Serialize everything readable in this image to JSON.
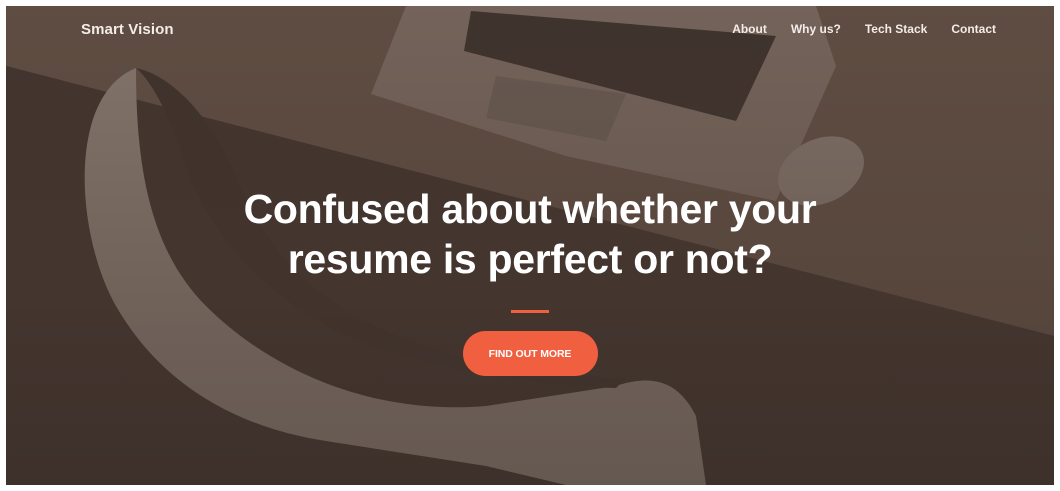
{
  "navbar": {
    "brand": "Smart Vision",
    "links": [
      {
        "label": "About"
      },
      {
        "label": "Why us?"
      },
      {
        "label": "Tech Stack"
      },
      {
        "label": "Contact"
      }
    ]
  },
  "hero": {
    "title_line1": "Confused about whether your",
    "title_line2": "resume is perfect or not?",
    "cta_label": "FIND OUT MORE"
  },
  "colors": {
    "accent": "#f05f40",
    "overlay": "#483830",
    "text": "#ffffff"
  }
}
